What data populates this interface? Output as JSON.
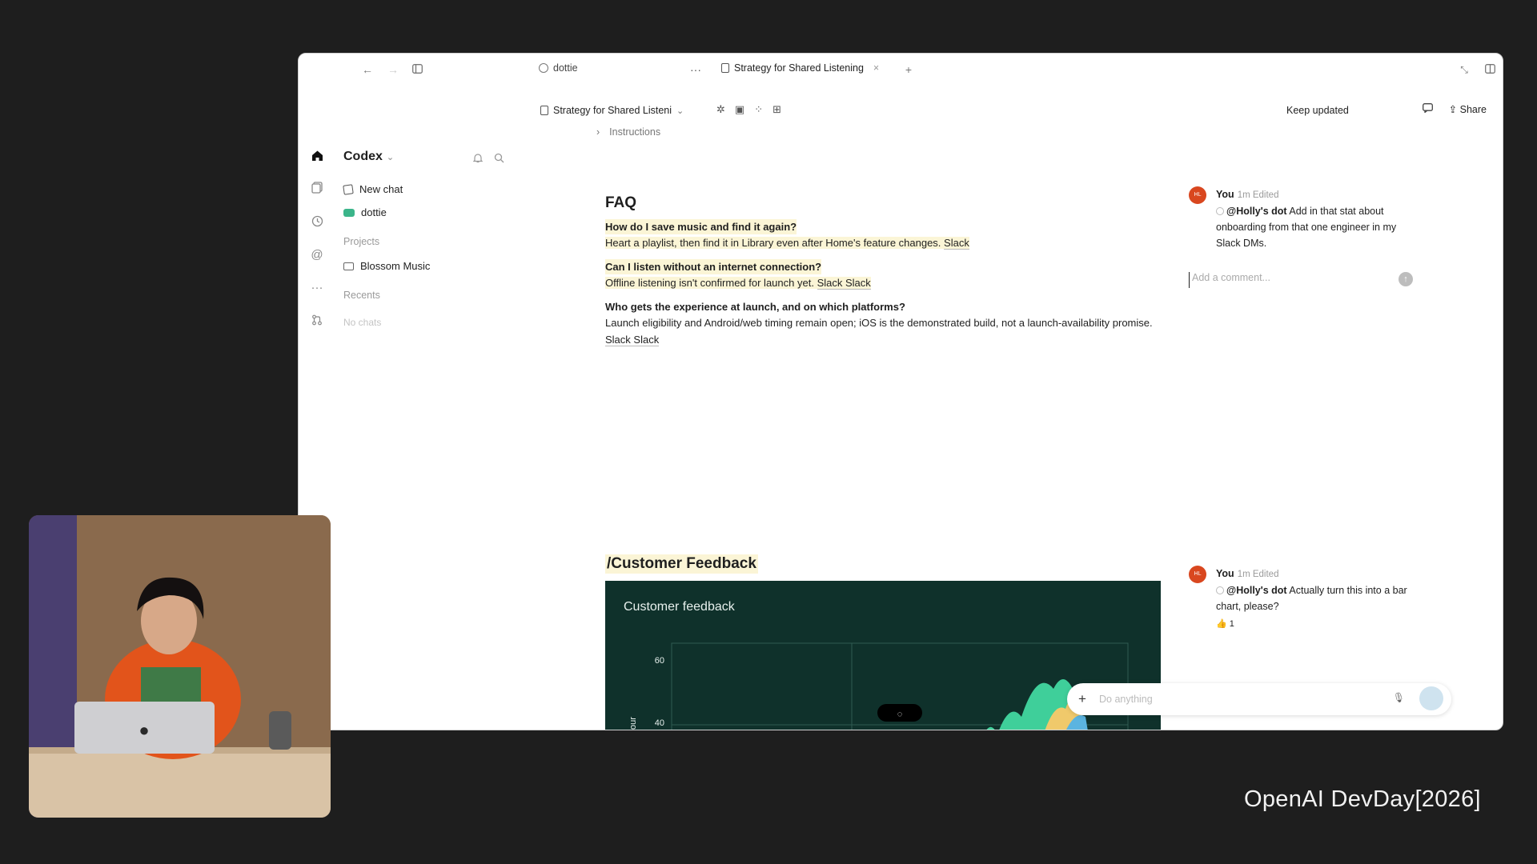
{
  "window": {
    "tabs": [
      {
        "label": "dottie",
        "icon": "chat-bubble-icon"
      },
      {
        "label": "Strategy for Shared Listening",
        "icon": "document-icon"
      }
    ],
    "more_label": "···",
    "new_tab": "+"
  },
  "sidebar": {
    "workspace": "Codex",
    "items": [
      {
        "label": "New chat",
        "icon": "pencil-icon"
      },
      {
        "label": "dottie",
        "icon": "bot-icon"
      }
    ],
    "projects_header": "Projects",
    "projects": [
      {
        "label": "Blossom Music",
        "icon": "folder-icon"
      }
    ],
    "recents_header": "Recents",
    "recents_empty": "No chats"
  },
  "doc_header": {
    "title": "Strategy for Shared Listeni",
    "keep_updated": "Keep updated",
    "share": "Share",
    "breadcrumb": "Instructions"
  },
  "faq": {
    "heading": "FAQ",
    "items": [
      {
        "q": "How do I save music and find it again?",
        "a": "Heart a playlist, then find it in Library even after Home's feature changes.",
        "src": "Slack"
      },
      {
        "q": "Can I listen without an internet connection?",
        "a": "Offline listening isn't confirmed for launch yet.",
        "src": "Slack Slack"
      },
      {
        "q": "Who gets the experience at launch, and on which platforms?",
        "a": "Launch eligibility and Android/web timing remain open; iOS is the demonstrated build, not a launch-availability promise.",
        "src": "Slack Slack"
      }
    ]
  },
  "feedback": {
    "heading": "/Customer Feedback",
    "chart_title": "Customer feedback",
    "y_ticks": [
      "60",
      "40"
    ],
    "y_label": "our"
  },
  "comments": [
    {
      "author": "You",
      "meta": "1m Edited",
      "mention": "@Holly's dot",
      "text": "Add in that stat about onboarding from that one engineer in my Slack DMs.",
      "initials": "HL"
    },
    {
      "author": "You",
      "meta": "1m Edited",
      "mention": "@Holly's dot",
      "text": "Actually turn this into a bar chart, please?",
      "initials": "HL",
      "reaction": "1"
    }
  ],
  "comment_input": {
    "placeholder": "Add a comment..."
  },
  "composer": {
    "placeholder": "Do anything"
  },
  "branding": {
    "text": "OpenAI DevDay[2026]"
  },
  "chart_data": {
    "type": "area",
    "title": "Customer feedback",
    "ylabel": "our",
    "y_ticks": [
      60,
      40
    ]
  }
}
